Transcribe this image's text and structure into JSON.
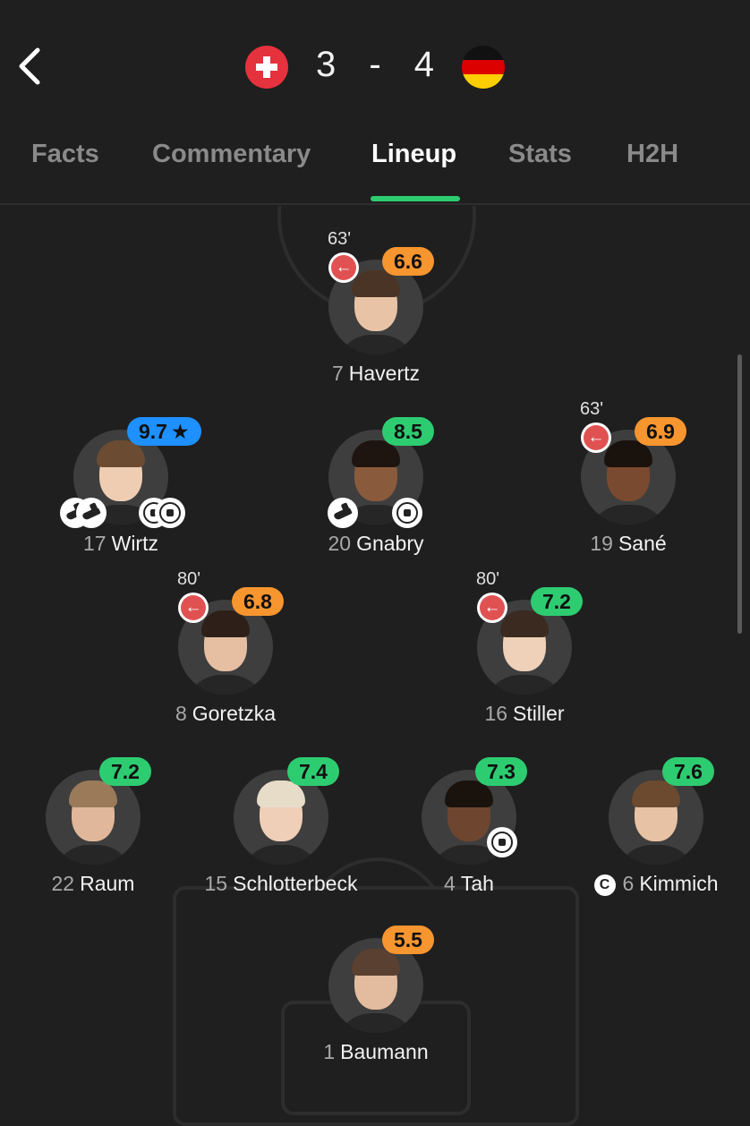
{
  "header": {
    "home_flag": "Switzerland",
    "away_flag": "Germany",
    "home_score": "3",
    "separator": "-",
    "away_score": "4"
  },
  "tabs": [
    {
      "label": "Facts"
    },
    {
      "label": "Commentary"
    },
    {
      "label": "Lineup"
    },
    {
      "label": "Stats"
    },
    {
      "label": "H2H"
    }
  ],
  "active_tab": "Lineup",
  "colors": {
    "green": "#2ecc71",
    "orange": "#f7952f",
    "blue": "#1e90ff",
    "sub_red": "#e05252"
  },
  "players": {
    "havertz": {
      "number": "7",
      "name": "Havertz",
      "rating": "6.6",
      "rating_color": "orange",
      "sub_minute": "63'"
    },
    "wirtz": {
      "number": "17",
      "name": "Wirtz",
      "rating": "9.7",
      "rating_color": "blue",
      "star": "★",
      "events": [
        "assist",
        "assist",
        "goal",
        "goal"
      ]
    },
    "gnabry": {
      "number": "20",
      "name": "Gnabry",
      "rating": "8.5",
      "rating_color": "green",
      "events": [
        "assist",
        "goal"
      ]
    },
    "sane": {
      "number": "19",
      "name": "Sané",
      "rating": "6.9",
      "rating_color": "orange",
      "sub_minute": "63'"
    },
    "goretzka": {
      "number": "8",
      "name": "Goretzka",
      "rating": "6.8",
      "rating_color": "orange",
      "sub_minute": "80'"
    },
    "stiller": {
      "number": "16",
      "name": "Stiller",
      "rating": "7.2",
      "rating_color": "green",
      "sub_minute": "80'"
    },
    "raum": {
      "number": "22",
      "name": "Raum",
      "rating": "7.2",
      "rating_color": "green"
    },
    "schlotterbeck": {
      "number": "15",
      "name": "Schlotterbeck",
      "rating": "7.4",
      "rating_color": "green"
    },
    "tah": {
      "number": "4",
      "name": "Tah",
      "rating": "7.3",
      "rating_color": "green",
      "events": [
        "goal"
      ]
    },
    "kimmich": {
      "number": "6",
      "name": "Kimmich",
      "rating": "7.6",
      "rating_color": "green",
      "captain": "C"
    },
    "baumann": {
      "number": "1",
      "name": "Baumann",
      "rating": "5.5",
      "rating_color": "orange"
    }
  }
}
